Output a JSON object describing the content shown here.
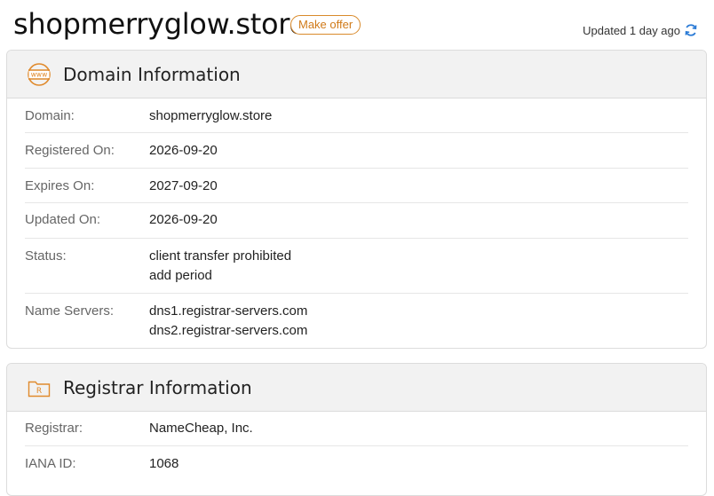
{
  "header": {
    "domain": "shopmerryglow.store",
    "make_offer": "Make offer",
    "updated": "Updated 1 day ago"
  },
  "domain_info": {
    "title": "Domain Information",
    "icon_text": "www",
    "rows": [
      {
        "label": "Domain:",
        "values": [
          "shopmerryglow.store"
        ]
      },
      {
        "label": "Registered On:",
        "values": [
          "2026-09-20"
        ]
      },
      {
        "label": "Expires On:",
        "values": [
          "2027-09-20"
        ]
      },
      {
        "label": "Updated On:",
        "values": [
          "2026-09-20"
        ]
      },
      {
        "label": "Status:",
        "values": [
          "client transfer prohibited",
          "add period"
        ]
      },
      {
        "label": "Name Servers:",
        "values": [
          "dns1.registrar-servers.com",
          "dns2.registrar-servers.com"
        ]
      }
    ]
  },
  "registrar_info": {
    "title": "Registrar Information",
    "icon_text": "R",
    "rows": [
      {
        "label": "Registrar:",
        "values": [
          "NameCheap, Inc."
        ]
      },
      {
        "label": "IANA ID:",
        "values": [
          "1068"
        ]
      }
    ]
  },
  "colors": {
    "accent": "#e08a2c",
    "refresh_icon": "#2b7bd6"
  }
}
